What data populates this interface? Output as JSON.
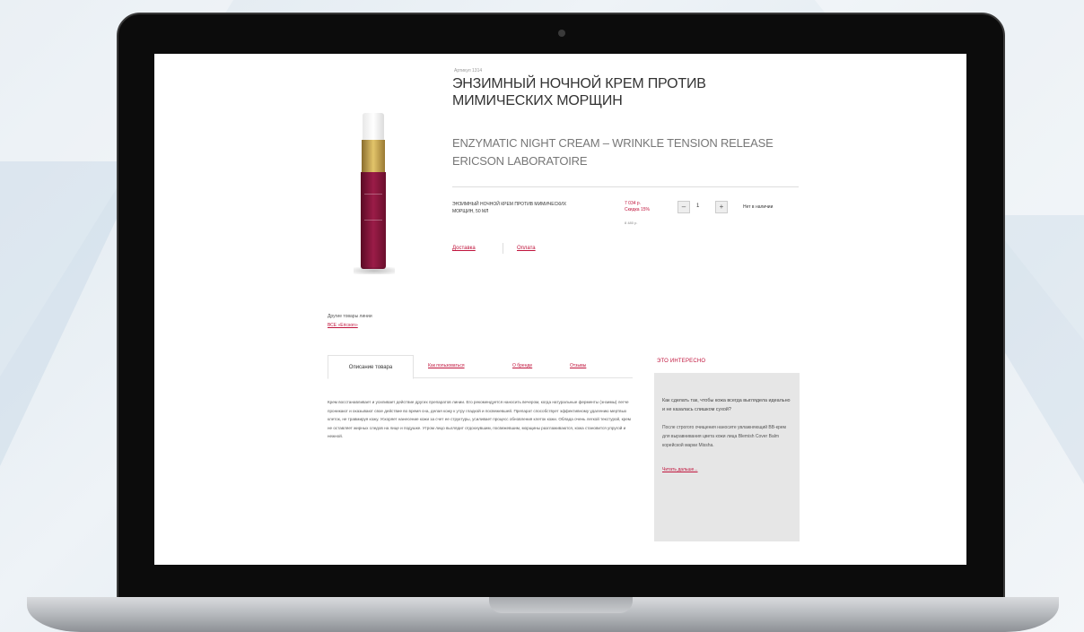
{
  "product": {
    "breadcrumb": "Артикул 1314",
    "title_ru": "ЭНЗИМНЫЙ НОЧНОЙ КРЕМ ПРОТИВ МИМИЧЕСКИХ МОРЩИН",
    "title_en": "ENZYMATIC NIGHT CREAM – WRINKLE TENSION RELEASE",
    "brand": "ERICSON LABORATOIRE",
    "variant_name": "ЭНЗИМНЫЙ НОЧНОЙ КРЕМ ПРОТИВ МИМИЧЕСКИХ МОРЩИН, 50 МЛ",
    "price": "7 034 р.",
    "discount": "Скидка 15%",
    "price_old": "8 480 р.",
    "qty_minus": "–",
    "qty_value": "1",
    "qty_plus": "+",
    "cart_status": "Нет в наличии"
  },
  "links": {
    "delivery": "Доставка",
    "payment": "Оплата",
    "other_label": "Другие товары линии",
    "other_link": "ВСЕ «Ericson»"
  },
  "tabs": [
    {
      "label": "Описание товара"
    },
    {
      "label": "Как пользоваться"
    },
    {
      "label": "О бренде"
    },
    {
      "label": "Отзывы"
    }
  ],
  "description": "Крем восстанавливает и усиливает действие других препаратов линии. Его рекомендуется наносить вечером, когда натуральные ферменты (энзимы) легче проникают и оказывают свое действие во время сна, делая кожу к утру гладкой и посвежевшей. Препарат способствует эффективному удалению мертвых клеток, не травмируя кожу. Ускоряет нанесение кожи за счет ее структуры, усиливает процесс обновления клеток кожи. Облада очень легкой текстурой, крем не оставляет жирных следов на лице и подушке. Утром лицо выглядит отдохнувшим, посвежевшим, морщины разглаживаются, кожа становится упругой и нежной.",
  "sidebar": {
    "title": "ЭТО ИНТЕРЕСНО",
    "question": "Как сделать так, чтобы кожа всегда выглядела идеально и не казалась слишком сухой?",
    "text": "После строгого очищения наносите увлажняющий BB-крем для выравнивания цвета кожи лица Blemish Cover Balm корейской марки Missha.",
    "more": "Читать дальше..."
  }
}
